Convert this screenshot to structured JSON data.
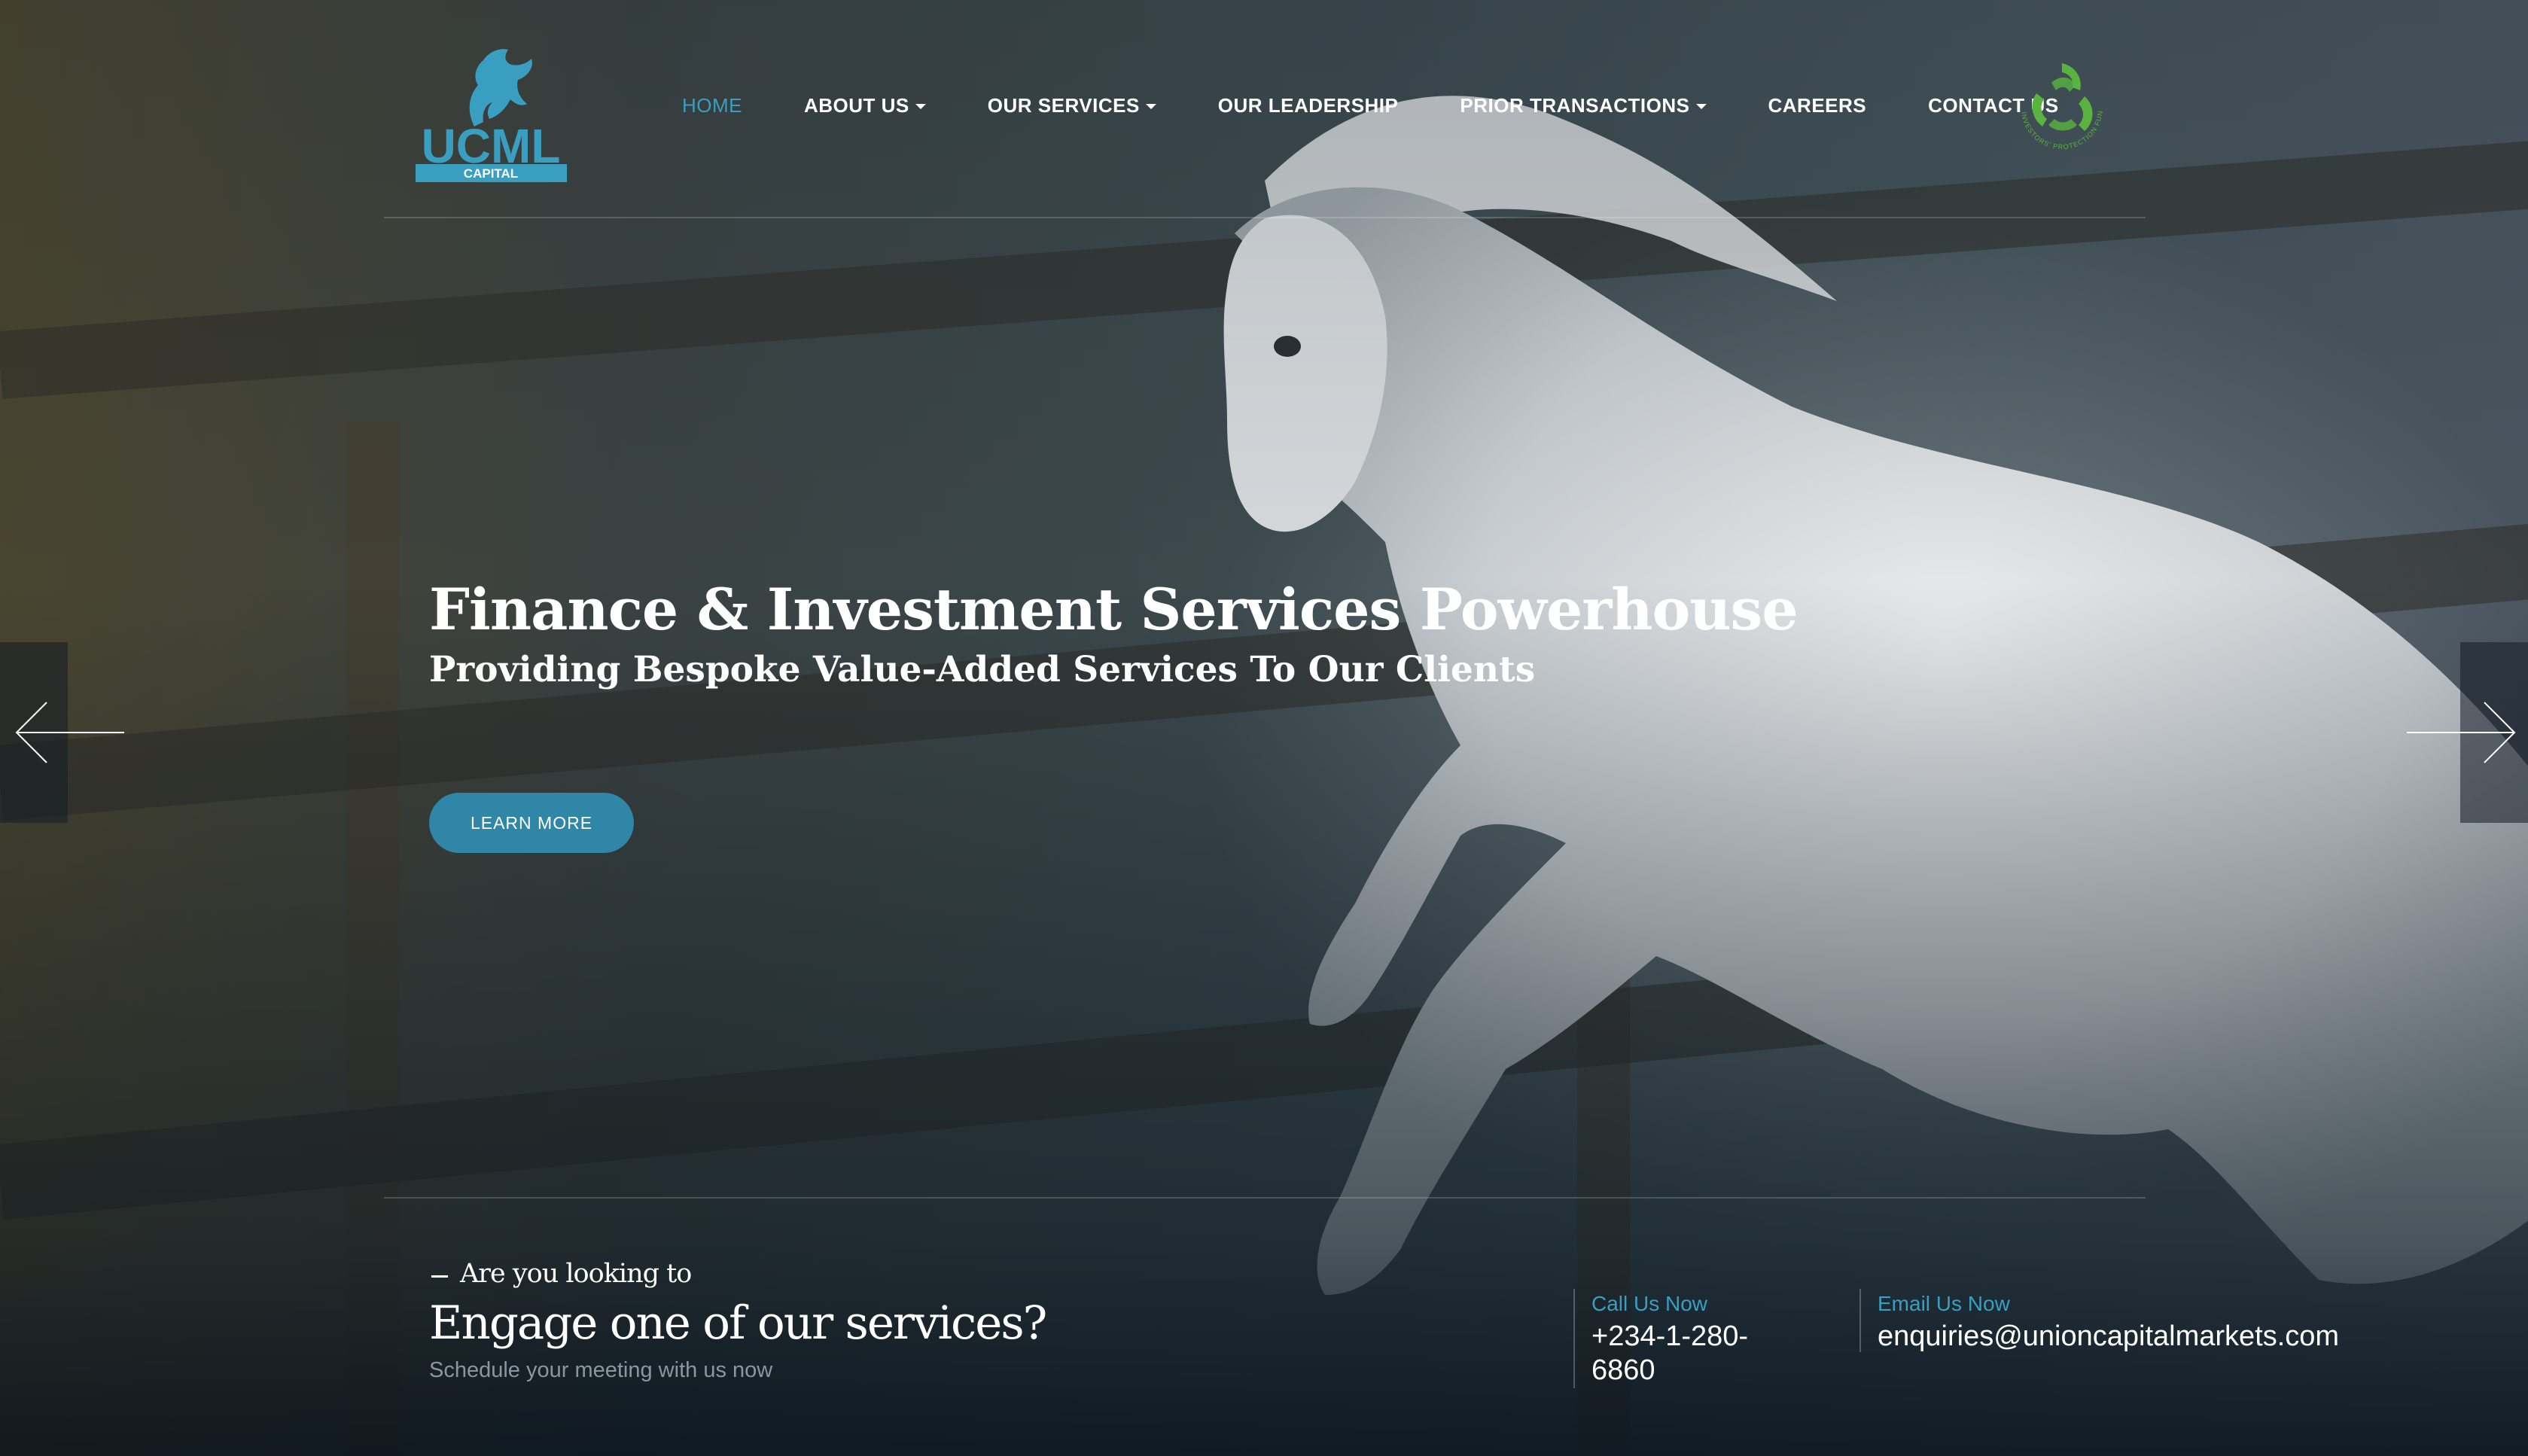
{
  "brand": {
    "logo_text": "UCML",
    "logo_sub": "CAPITAL",
    "partner_logo_text": "INVESTORS' PROTECTION FUND",
    "accent_color": "#3a9ec0",
    "button_color": "#2f86a6",
    "partner_color": "#5ab33e"
  },
  "nav": {
    "items": [
      {
        "label": "HOME",
        "active": true,
        "dropdown": false
      },
      {
        "label": "ABOUT US",
        "active": false,
        "dropdown": true
      },
      {
        "label": "OUR SERVICES",
        "active": false,
        "dropdown": true
      },
      {
        "label": "OUR LEADERSHIP",
        "active": false,
        "dropdown": false
      },
      {
        "label": "PRIOR TRANSACTIONS",
        "active": false,
        "dropdown": true
      },
      {
        "label": "CAREERS",
        "active": false,
        "dropdown": false
      },
      {
        "label": "CONTACT US",
        "active": false,
        "dropdown": false
      }
    ]
  },
  "hero": {
    "headline": "Finance & Investment Services Powerhouse",
    "subheadline": "Providing Bespoke Value-Added Services To Our Clients",
    "cta_label": "LEARN MORE",
    "prev_icon": "arrow-left-icon",
    "next_icon": "arrow-right-icon"
  },
  "engage": {
    "kicker": "Are you looking to",
    "title": "Engage one of our services?",
    "note": "Schedule your meeting with us now"
  },
  "contact": {
    "call_label": "Call Us Now",
    "call_line1": "+234-1-280-",
    "call_line2": "6860",
    "email_label": "Email Us Now",
    "email_value": "enquiries@unioncapitalmarkets.com"
  }
}
